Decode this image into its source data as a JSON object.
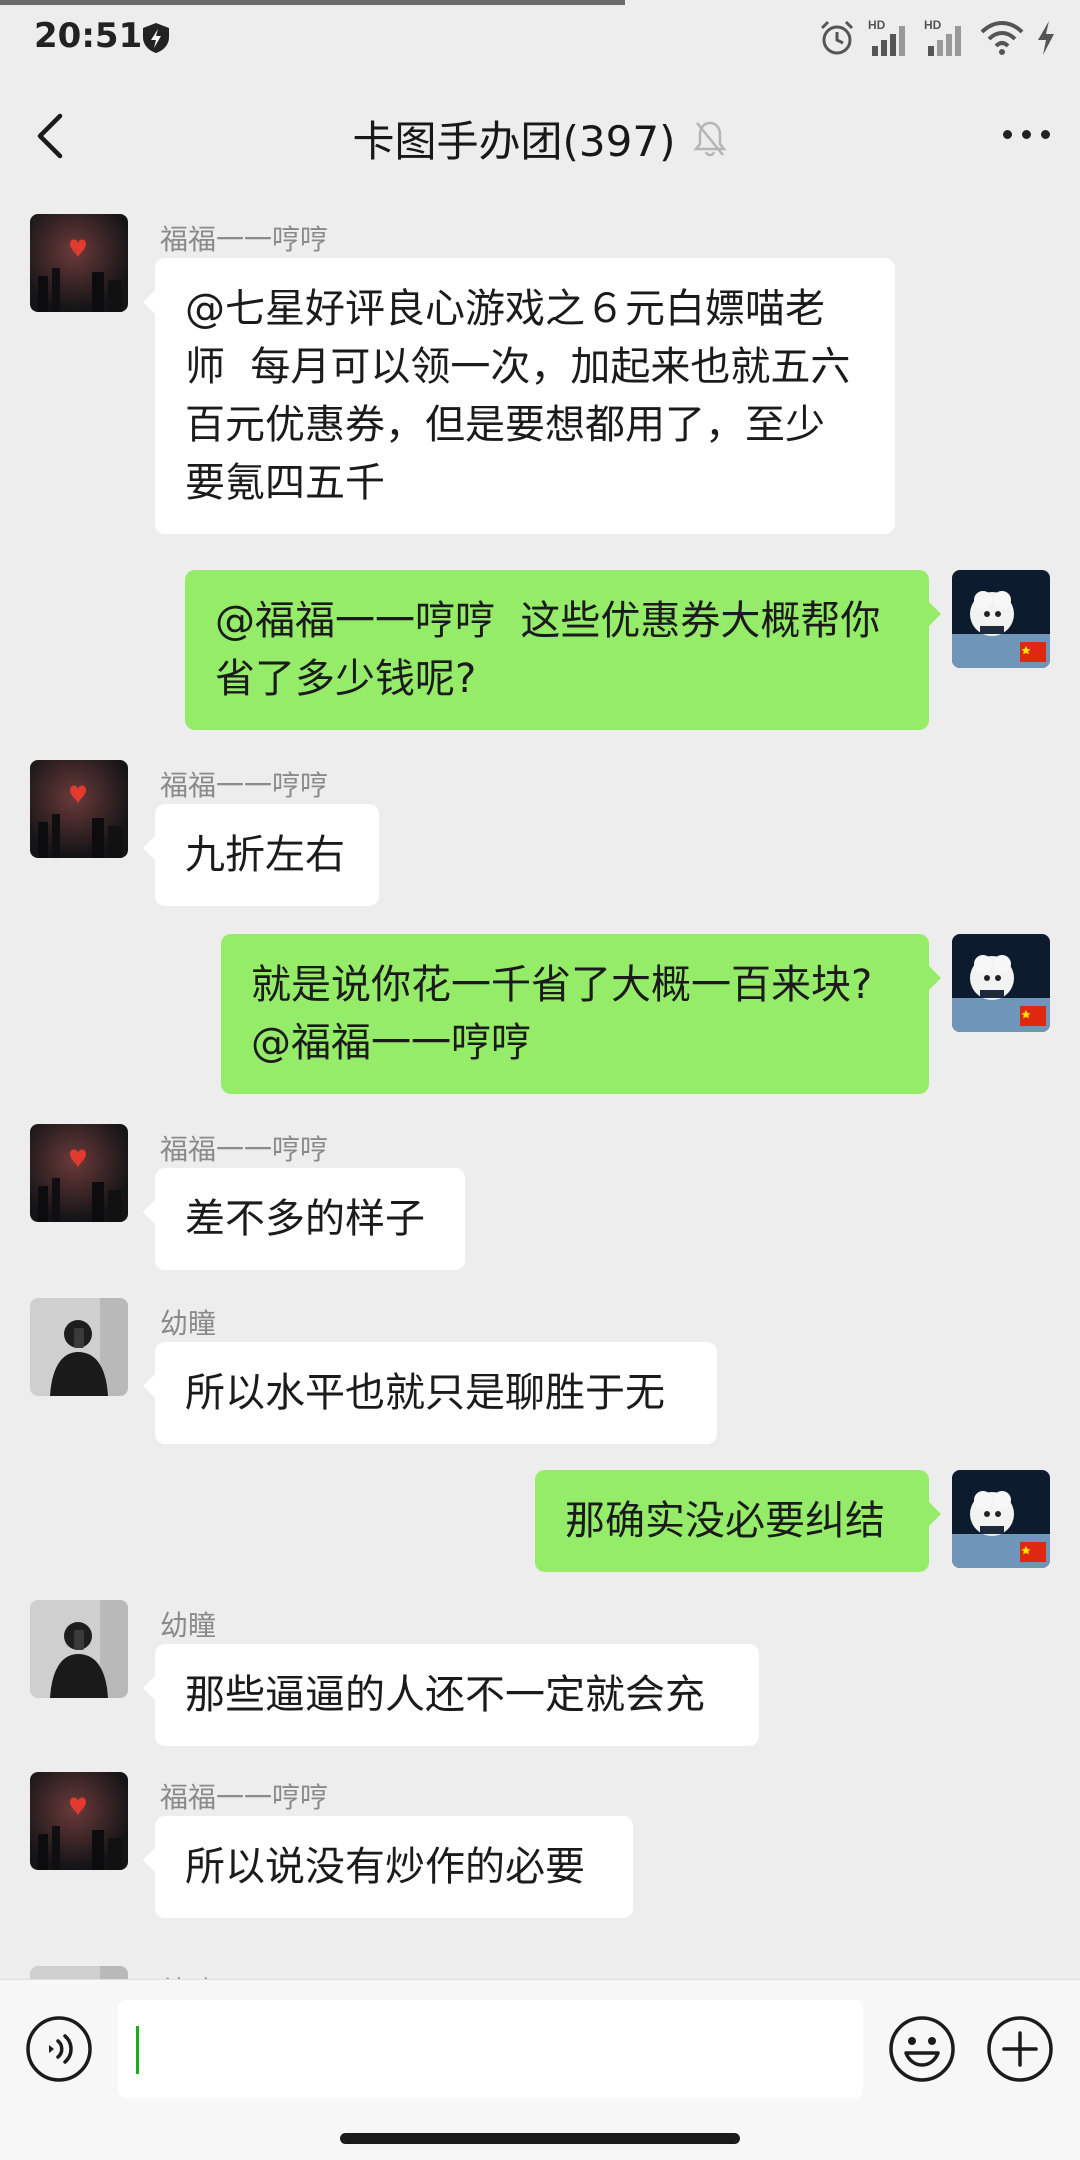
{
  "status_bar": {
    "time": "20:51",
    "icons": [
      "shield-icon",
      "alarm-icon",
      "signal-hd-1-icon",
      "signal-hd-2-icon",
      "wifi-icon",
      "charging-icon"
    ],
    "hd_label": "HD"
  },
  "header": {
    "title": "卡图手办团(397)",
    "icons": [
      "back-icon",
      "mute-bell-icon",
      "more-icon"
    ]
  },
  "colors": {
    "accent": "#95ec69",
    "background": "#ededed",
    "bubble_in": "#ffffff"
  },
  "messages": [
    {
      "direction": "in",
      "sender": "福福一一哼哼",
      "lines": [
        "@七星好评良心游戏之６元白嫖喵老",
        "师  每月可以领一次，加起来也就五六",
        "百元优惠券，但是要想都用了，至少",
        "要氪四五千"
      ]
    },
    {
      "direction": "out",
      "lines": [
        "@福福一一哼哼  这些优惠券大概帮你",
        "省了多少钱呢?"
      ]
    },
    {
      "direction": "in",
      "sender": "福福一一哼哼",
      "lines": [
        "九折左右"
      ]
    },
    {
      "direction": "out",
      "lines": [
        "就是说你花一千省了大概一百来块?",
        "@福福一一哼哼"
      ]
    },
    {
      "direction": "in",
      "sender": "福福一一哼哼",
      "lines": [
        "差不多的样子"
      ]
    },
    {
      "direction": "in",
      "sender": "幼瞳",
      "lines": [
        "所以水平也就只是聊胜于无"
      ]
    },
    {
      "direction": "out",
      "lines": [
        "那确实没必要纠结"
      ]
    },
    {
      "direction": "in",
      "sender": "幼瞳",
      "lines": [
        "那些逼逼的人还不一定就会充"
      ]
    },
    {
      "direction": "in",
      "sender": "福福一一哼哼",
      "lines": [
        "所以说没有炒作的必要"
      ]
    },
    {
      "direction": "in",
      "sender": "幼瞳",
      "lines": []
    }
  ],
  "input_bar": {
    "text_value": "",
    "icons": [
      "voice-icon",
      "emoji-icon",
      "plus-icon"
    ]
  }
}
